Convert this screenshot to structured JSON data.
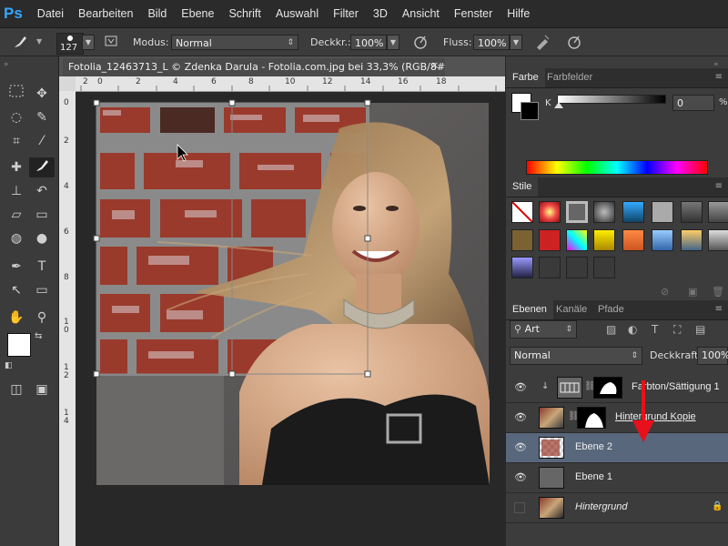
{
  "app": {
    "logo": "Ps"
  },
  "menu": [
    "Datei",
    "Bearbeiten",
    "Bild",
    "Ebene",
    "Schrift",
    "Auswahl",
    "Filter",
    "3D",
    "Ansicht",
    "Fenster",
    "Hilfe"
  ],
  "options_bar": {
    "brush_size": "127",
    "mode_label": "Modus:",
    "mode_value": "Normal",
    "opacity_label": "Deckkr.:",
    "opacity_value": "100%",
    "flow_label": "Fluss:",
    "flow_value": "100%"
  },
  "document": {
    "tab_title": "Fotolia_12463713_L © Zdenka Darula - Fotolia.com.jpg bei 33,3% (RGB/8#)",
    "close": "×",
    "ruler_top_labels": [
      "2",
      "0",
      "2",
      "4",
      "6",
      "8",
      "10",
      "12",
      "14",
      "16",
      "18"
    ],
    "ruler_left_labels": [
      "0",
      "2",
      "4",
      "6",
      "8",
      "1\n0",
      "1\n2",
      "1\n4"
    ]
  },
  "color_panel": {
    "tabs": [
      "Farbe",
      "Farbfelder"
    ],
    "channel_label": "K",
    "value": "0",
    "unit": "%"
  },
  "styles_panel": {
    "tabs": [
      "Stile"
    ]
  },
  "layers_panel": {
    "tabs": [
      "Ebenen",
      "Kanäle",
      "Pfade"
    ],
    "filter_type": "Art",
    "blend_mode": "Normal",
    "opacity_label": "Deckkraft:",
    "opacity_value": "100%",
    "layers": [
      {
        "name": "Farbton/Sättigung 1",
        "visible": true,
        "selected": false
      },
      {
        "name": "Hintergrund Kopie",
        "visible": true,
        "selected": false
      },
      {
        "name": "Ebene 2",
        "visible": true,
        "selected": true
      },
      {
        "name": "Ebene 1",
        "visible": true,
        "selected": false
      },
      {
        "name": "Hintergrund",
        "visible": false,
        "selected": false
      }
    ]
  },
  "colors": {
    "accent_ps": "#31a8ff",
    "annotation_arrow": "#e8101a",
    "selected_layer": "#59677c",
    "brick": "#9a3a2c"
  },
  "icons": [
    "brush-icon",
    "eye-icon",
    "lock-icon",
    "chain-icon",
    "close-icon"
  ]
}
